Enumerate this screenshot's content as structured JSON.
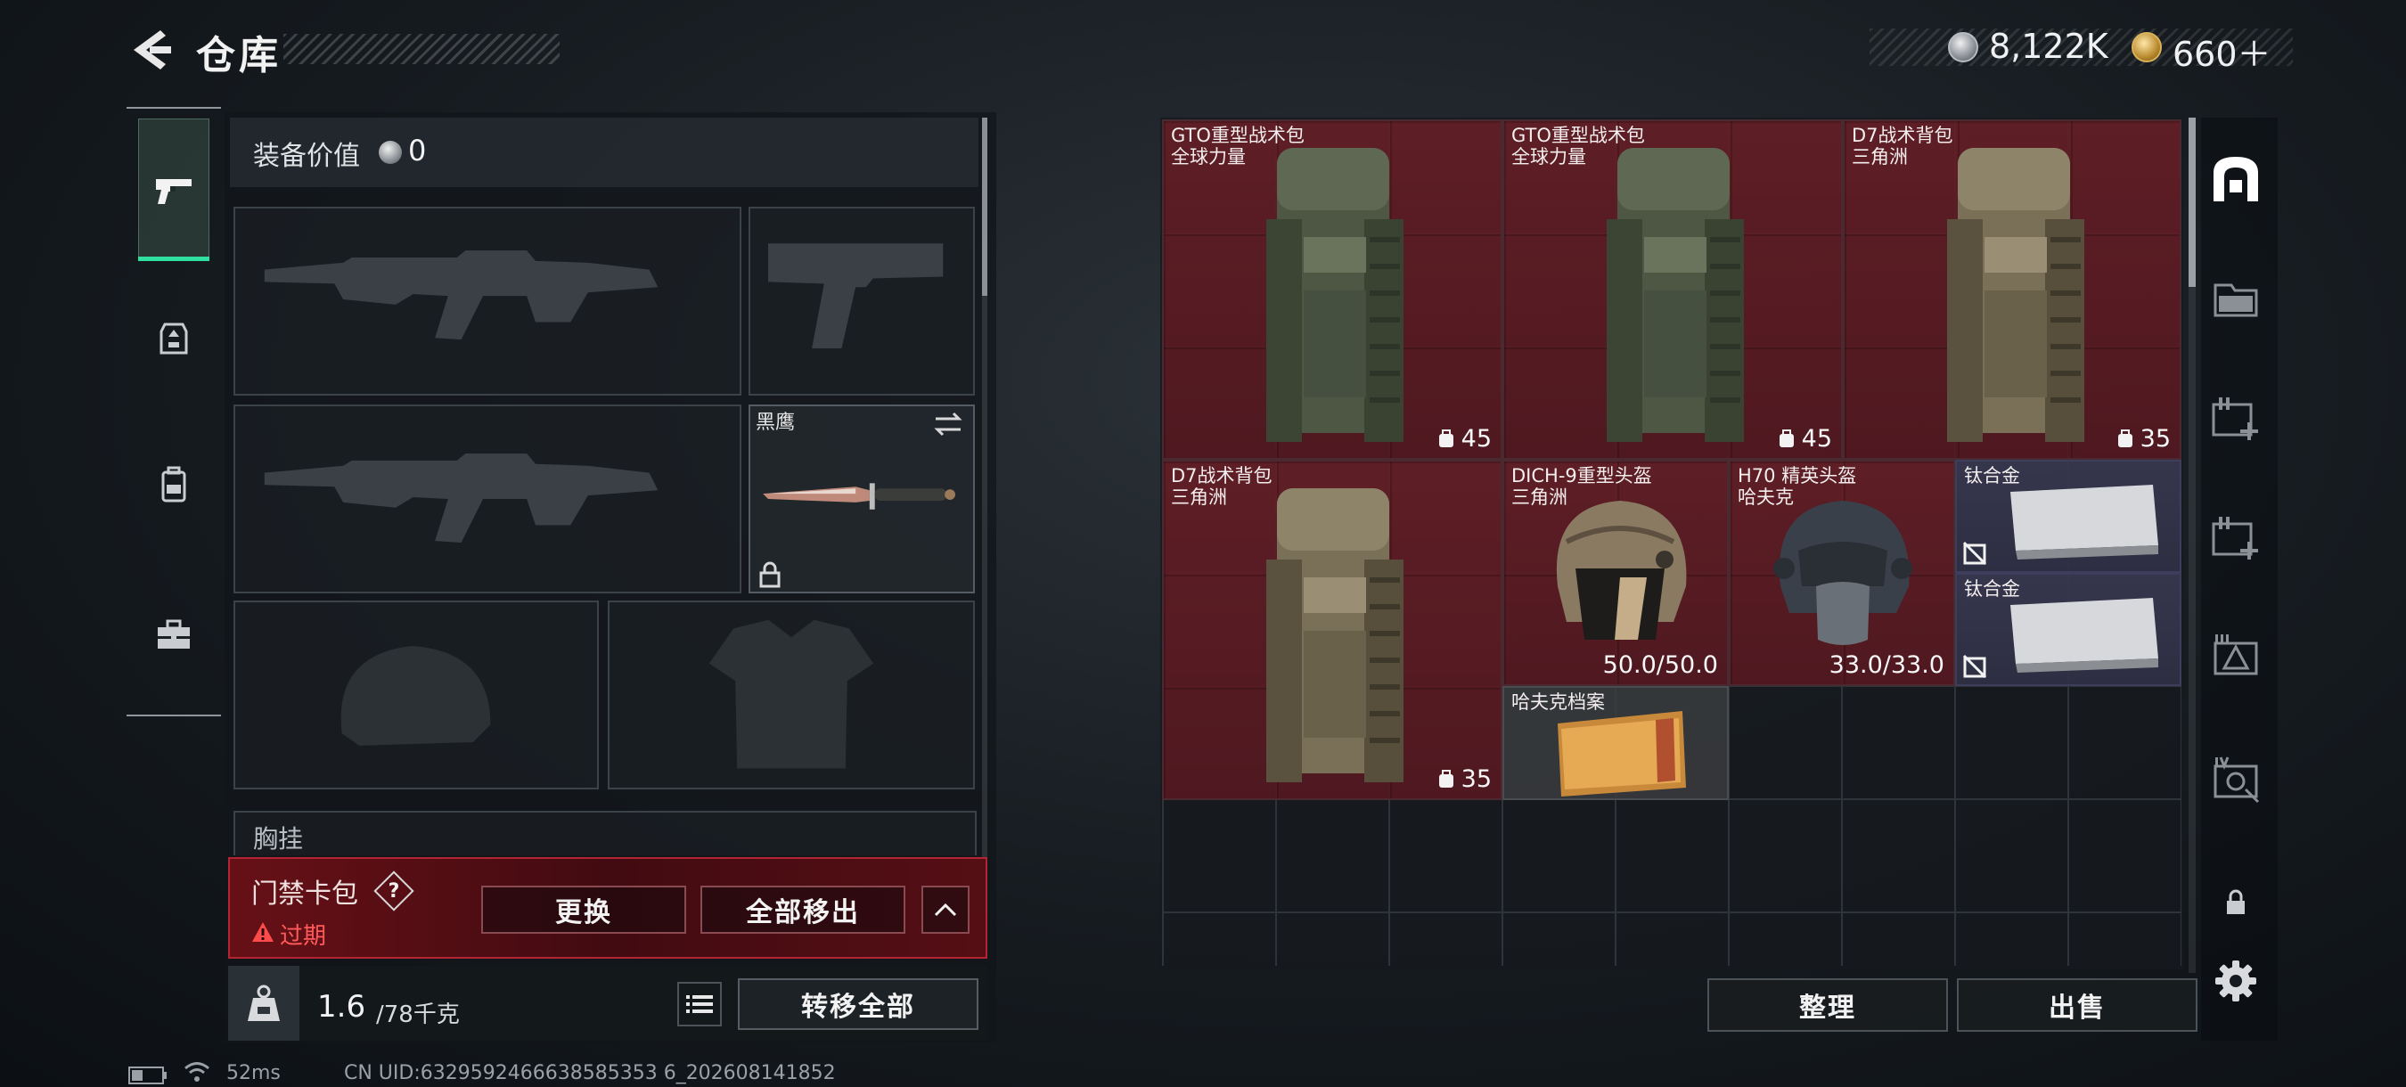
{
  "header": {
    "title": "仓库",
    "currency_silver": "8,122K",
    "currency_gold": "660＋"
  },
  "left_panel": {
    "equip_value_label": "装备价值",
    "equip_value": "0",
    "melee_name": "黑鹰",
    "chest_rig_label": "胸挂"
  },
  "access_card": {
    "title": "门禁卡包",
    "help": "?",
    "status": "过期",
    "replace_label": "更换",
    "remove_all_label": "全部移出"
  },
  "weight": {
    "current": "1.6",
    "max": "/78千克",
    "transfer_all_label": "转移全部"
  },
  "status_bar": {
    "latency": "52ms",
    "uid": "CN UID:6329592466638585353 6_202608141852"
  },
  "storage": {
    "items": [
      {
        "name": "GTO重型战术包",
        "sub": "全球力量",
        "count": "45",
        "rarity": "red"
      },
      {
        "name": "GTO重型战术包",
        "sub": "全球力量",
        "count": "45",
        "rarity": "red"
      },
      {
        "name": "D7战术背包",
        "sub": "三角洲",
        "count": "35",
        "rarity": "red"
      },
      {
        "name": "D7战术背包",
        "sub": "三角洲",
        "count": "35",
        "rarity": "red"
      },
      {
        "name": "DICH-9重型头盔",
        "sub": "三角洲",
        "durability": "50.0/50.0",
        "rarity": "red"
      },
      {
        "name": "H70 精英头盔",
        "sub": "哈夫克",
        "durability": "33.0/33.0",
        "rarity": "red"
      },
      {
        "name": "钛合金",
        "rarity": "purple"
      },
      {
        "name": "钛合金",
        "rarity": "purple"
      },
      {
        "name": "哈夫克档案",
        "rarity": "gray"
      }
    ],
    "sort_label": "整理",
    "sell_label": "出售"
  },
  "colors": {
    "accent_green": "#2fe0a0",
    "rarity_red": "#641e26",
    "rarity_purple": "#383850",
    "warning_red": "#ff5a5a"
  },
  "icons": [
    "back-icon",
    "coin-silver-icon",
    "coin-gold-icon",
    "pistol-icon",
    "helmet-armor-icon",
    "backpack-icon",
    "toolbox-icon",
    "lock-icon",
    "swap-icon",
    "weight-icon",
    "list-icon",
    "home-icon",
    "folder-icon",
    "medkit-icon",
    "tier-3-icon",
    "tier-4-icon",
    "settings-icon"
  ]
}
